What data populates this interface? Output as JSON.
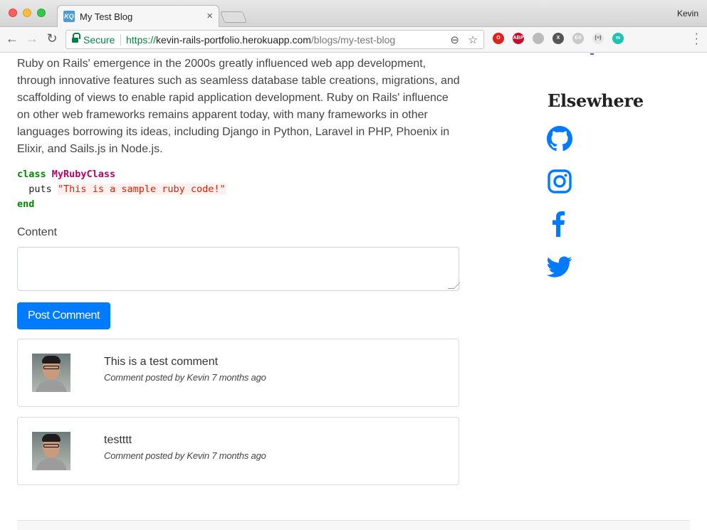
{
  "browser": {
    "tab_title": "My Test Blog",
    "tab_favicon_text": "KQ",
    "tab_close": "×",
    "profile_name": "Kevin",
    "secure_label": "Secure",
    "url_scheme": "https://",
    "url_host": "kevin-rails-portfolio.herokuapp.com",
    "url_path": "/blogs/my-test-blog",
    "extensions": [
      {
        "name": "opera",
        "text": "O",
        "color": "#e0201a"
      },
      {
        "name": "adblock",
        "text": "ABP",
        "color": "#c70d2c"
      },
      {
        "name": "shield",
        "text": "",
        "color": "#bbbbbb"
      },
      {
        "name": "x",
        "text": "X",
        "color": "#555555"
      },
      {
        "name": "es",
        "text": "ES",
        "color": "#c9c9c9"
      },
      {
        "name": "json",
        "text": "{≡}",
        "color": "#e8e8e8"
      },
      {
        "name": "m",
        "text": "m",
        "color": "#1dc3b2"
      }
    ]
  },
  "post": {
    "paragraph": "Ruby on Rails' emergence in the 2000s greatly influenced web app development, through innovative features such as seamless database table creations, migrations, and scaffolding of views to enable rapid application development. Ruby on Rails' influence on other web frameworks remains apparent today, with many frameworks in other languages borrowing its ideas, including Django in Python, Laravel in PHP, Phoenix in Elixir, and Sails.js in Node.js.",
    "code": {
      "kw_class": "class",
      "class_name": "MyRubyClass",
      "call": "puts",
      "string": "\"This is a sample ruby code!\"",
      "kw_end": "end"
    }
  },
  "comment_form": {
    "label": "Content",
    "textarea_value": "",
    "submit_label": "Post Comment"
  },
  "comments": [
    {
      "text": "This is a test comment",
      "meta": "Comment posted by Kevin 7 months ago"
    },
    {
      "text": "testttt",
      "meta": "Comment posted by Kevin 7 months ago"
    }
  ],
  "sidebar": {
    "title": "Elsewhere",
    "links": [
      {
        "name": "github",
        "color": "#007bff"
      },
      {
        "name": "instagram",
        "color": "#007bff"
      },
      {
        "name": "facebook",
        "color": "#007bff"
      },
      {
        "name": "twitter",
        "color": "#007bff"
      }
    ]
  }
}
